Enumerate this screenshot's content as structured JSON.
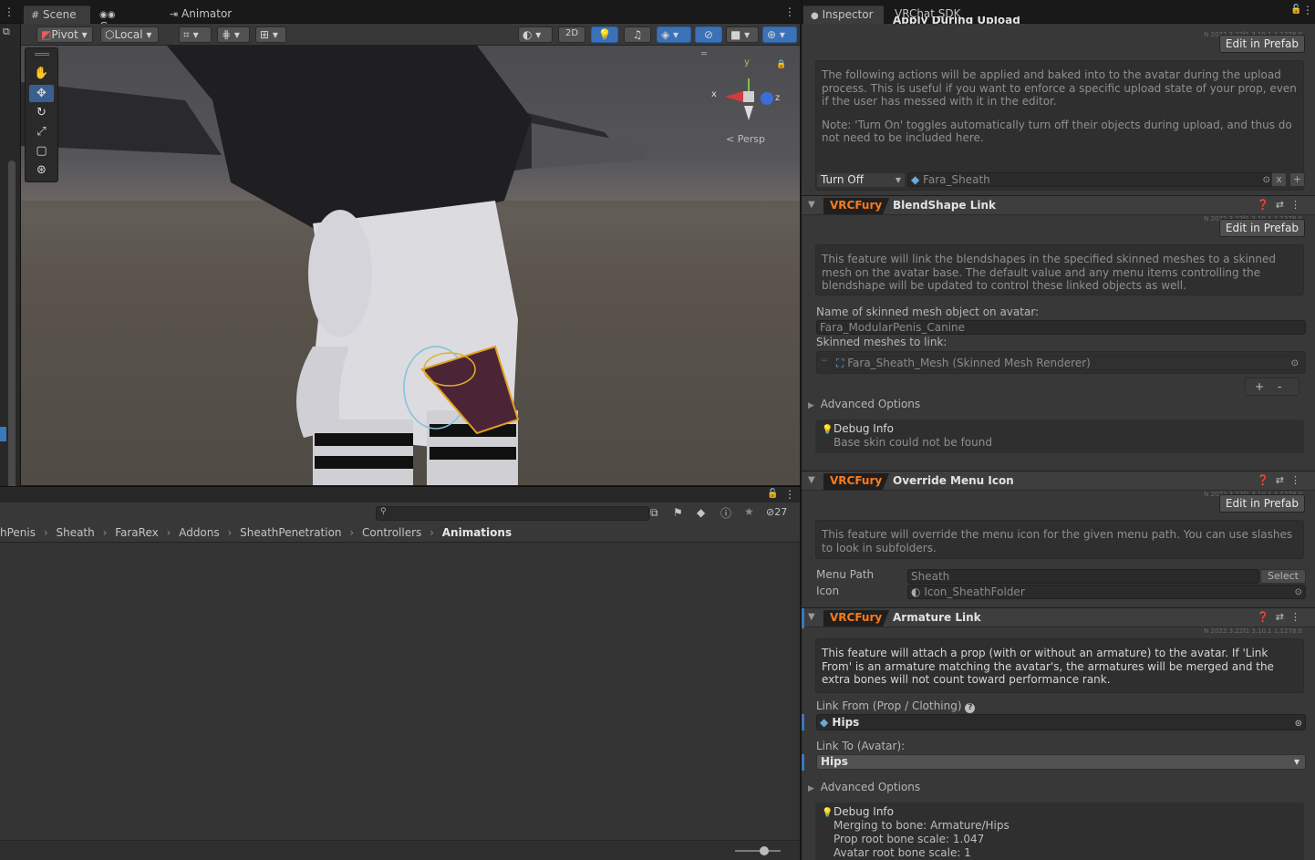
{
  "scene_tabs": [
    {
      "label": "Scene",
      "icon": "grid-icon",
      "active": true
    },
    {
      "label": "Game",
      "icon": "gamepad-icon",
      "active": false
    },
    {
      "label": "Animator",
      "icon": "animator-icon",
      "active": false
    }
  ],
  "scene_toolbar": {
    "pivot_label": "Pivot",
    "local_label": "Local",
    "mode_2d_label": "2D"
  },
  "viewport": {
    "persp_label": "Persp",
    "axis_x": "x",
    "axis_y": "y",
    "axis_z": "z"
  },
  "project": {
    "hidden_count": "27",
    "breadcrumb": [
      "hPenis",
      "Sheath",
      "FaraRex",
      "Addons",
      "SheathPenetration",
      "Controllers",
      "Animations"
    ]
  },
  "inspector_tabs": [
    {
      "label": "Inspector",
      "active": true
    },
    {
      "label": "VRChat SDK",
      "active": false
    }
  ],
  "apply_upload": {
    "title_partial": "Apply During Upload",
    "edit_prefab_label": "Edit in Prefab",
    "description": "The following actions will be applied and baked into to the avatar during the upload process. This is useful if you want to enforce a specific upload state of your prop, even if the user has messed with it in the editor.",
    "note": "Note: 'Turn On' toggles automatically turn off their objects during upload, and thus do not need to be included here.",
    "action_type": "Turn Off",
    "action_object": "Fara_Sheath",
    "remove_label": "x",
    "add_label": "+"
  },
  "blendshape_link": {
    "badge": "VRCFury",
    "title": "BlendShape Link",
    "edit_prefab_label": "Edit in Prefab",
    "description": "This feature will link the blendshapes in the specified skinned meshes to a skinned mesh on the avatar base. The default value and any menu items controlling the blendshape will be updated to control these linked objects as well.",
    "name_label": "Name of skinned mesh object on avatar:",
    "name_value": "Fara_ModularPenis_Canine",
    "meshes_label": "Skinned meshes to link:",
    "mesh_item": "Fara_Sheath_Mesh (Skinned Mesh Renderer)",
    "add_label": "+",
    "remove_label": "-",
    "advanced_label": "Advanced Options",
    "debug_title": "Debug Info",
    "debug_lines": [
      "Base skin could not be found"
    ]
  },
  "override_menu_icon": {
    "badge": "VRCFury",
    "title": "Override Menu Icon",
    "edit_prefab_label": "Edit in Prefab",
    "description": "This feature will override the menu icon for the given menu path. You can use slashes to look in subfolders.",
    "menu_path_label": "Menu Path",
    "menu_path_value": "Sheath",
    "select_label": "Select",
    "icon_label": "Icon",
    "icon_value": "Icon_SheathFolder"
  },
  "armature_link": {
    "badge": "VRCFury",
    "title": "Armature Link",
    "version": "N 2022.3.22f1 3.10.1 1.1278.0",
    "description": "This feature will attach a prop (with or without an armature) to the avatar. If 'Link From' is an armature matching the avatar's, the armatures will be merged and the extra bones will not count toward performance rank.",
    "link_from_label": "Link From (Prop / Clothing)",
    "link_from_value": "Hips",
    "link_to_label": "Link To (Avatar):",
    "link_to_value": "Hips",
    "advanced_label": "Advanced Options",
    "debug_title": "Debug Info",
    "debug_lines": [
      "Merging to bone: Armature/Hips",
      "Prop root bone scale: 1.047",
      "Avatar root bone scale: 1"
    ]
  },
  "colors": {
    "vrcfury_orange": "#ff7a18",
    "selection_blue": "#3a79bb",
    "panel_bg": "#383838"
  }
}
